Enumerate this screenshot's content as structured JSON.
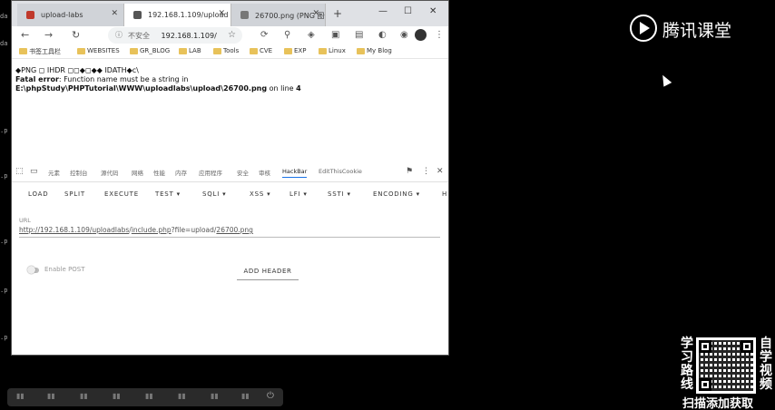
{
  "background": {
    "left_labels": [
      "da",
      "da",
      ".p",
      ".p",
      ".p",
      ".p",
      ".p"
    ]
  },
  "tabs": [
    {
      "label": "upload-labs",
      "fav_color": "#c0392b",
      "active": false
    },
    {
      "label": "192.168.1.109/upload",
      "fav_color": "#555555",
      "active": true
    },
    {
      "label": "26700.png (PNG 图像)",
      "fav_color": "#777777",
      "active": false
    }
  ],
  "window_controls": {
    "min": "—",
    "max": "☐",
    "close": "✕"
  },
  "toolbar": {
    "back": "←",
    "forward": "→",
    "reload": "↻",
    "address": {
      "insecure": "不安全",
      "url": "192.168.1.109/"
    }
  },
  "bookmarks": [
    "书签工具栏",
    "WEBSITES",
    "GR_BLOG",
    "LAB",
    "Tools",
    "CVE",
    "EXP",
    "Linux",
    "My Blog"
  ],
  "page": {
    "line1": "◆PNG ◻ IHDR ◻◻◆◻◆◆ IDATH◆c\\",
    "error_label": "Fatal error",
    "error_msg": ": Function name must be a string in",
    "path": "E:\\phpStudy\\PHPTutorial\\WWW\\uploadlabs\\upload\\26700.png",
    "on_line": " on line ",
    "line_no": "4"
  },
  "devtools": {
    "tabs": [
      "元素",
      "控制台",
      "源代码",
      "网络",
      "性能",
      "内存",
      "应用程序",
      "安全",
      "审核",
      "HackBar",
      "EditThisCookie"
    ],
    "active_tab": "HackBar"
  },
  "hackbar": {
    "menu": [
      "LOAD",
      "SPLIT",
      "EXECUTE",
      "TEST ▾",
      "SQLI ▾",
      "XSS ▾",
      "LFI ▾",
      "SSTI ▾",
      "ENCODING ▾",
      "H"
    ],
    "url_label": "URL",
    "url_parts": [
      "http://192.168.1.109/",
      "uploadlabs",
      "/",
      "include.php",
      "?file=upload/",
      "26700.png"
    ],
    "enable_post": "Enable POST",
    "add_header": "ADD HEADER"
  },
  "brand": {
    "name": "腾讯课堂"
  },
  "promo": {
    "left": [
      "学",
      "习",
      "路",
      "线"
    ],
    "right": [
      "自",
      "学",
      "视",
      "频"
    ],
    "caption": "扫描添加获取"
  },
  "player": {
    "power": "⏻"
  }
}
